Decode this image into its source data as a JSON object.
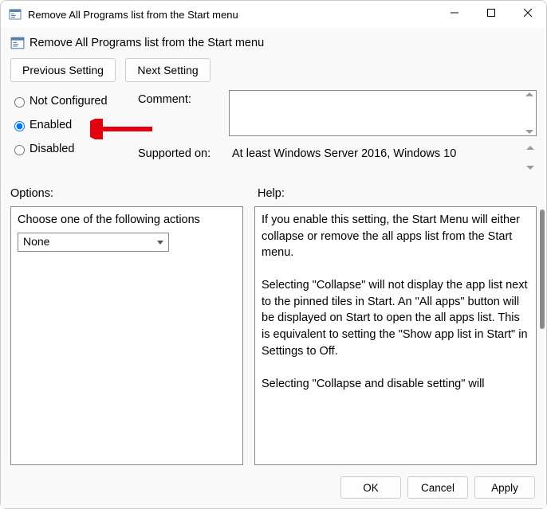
{
  "window": {
    "title": "Remove All Programs list from the Start menu",
    "header": "Remove All Programs list from the Start menu"
  },
  "nav": {
    "prev": "Previous Setting",
    "next": "Next Setting"
  },
  "state": {
    "not_configured": "Not Configured",
    "enabled": "Enabled",
    "disabled": "Disabled",
    "selected": "enabled"
  },
  "fields": {
    "comment_label": "Comment:",
    "comment_value": "",
    "supported_label": "Supported on:",
    "supported_value": "At least Windows Server 2016, Windows 10"
  },
  "panes": {
    "options_label": "Options:",
    "help_label": "Help:",
    "options_text": "Choose one of the following actions",
    "options_selected": "None"
  },
  "help_text": "If you enable this setting, the Start Menu will either collapse or remove the all apps list from the Start menu.\n\nSelecting \"Collapse\" will not display the app list next to the pinned tiles in Start. An \"All apps\" button will be displayed on Start to open the all apps list. This is equivalent to setting the \"Show app list in Start\" in Settings to Off.\n\nSelecting \"Collapse and disable setting\" will",
  "footer": {
    "ok": "OK",
    "cancel": "Cancel",
    "apply": "Apply"
  }
}
